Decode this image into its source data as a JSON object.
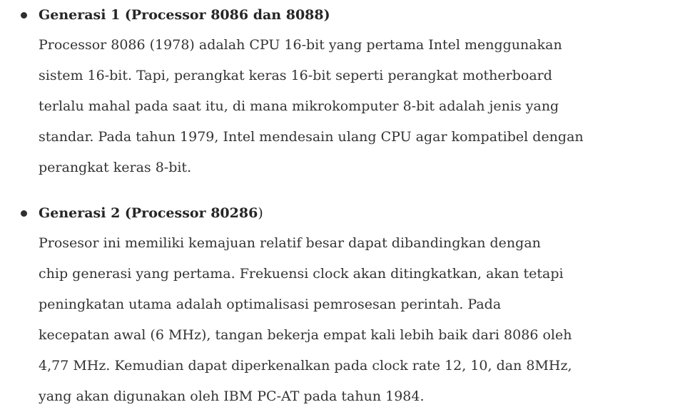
{
  "generations": [
    {
      "heading_bold": "Generasi 1 (Processor 8086 dan 8088)",
      "heading_tail": "",
      "lines": [
        "Processor 8086 (1978) adalah CPU 16-bit yang pertama Intel menggunakan",
        "sistem 16-bit. Tapi, perangkat keras 16-bit seperti perangkat motherboard",
        "terlalu mahal pada saat itu, di mana mikrokomputer 8-bit adalah jenis yang",
        "standar. Pada tahun 1979, Intel mendesain ulang CPU agar kompatibel dengan",
        "perangkat keras 8-bit."
      ]
    },
    {
      "heading_bold": "Generasi 2 (Processor 80286",
      "heading_tail": ")",
      "lines": [
        "Prosesor ini memiliki kemajuan relatif besar dapat dibandingkan dengan",
        "chip generasi yang pertama. Frekuensi clock akan ditingkatkan, akan tetapi",
        "peningkatan utama adalah optimalisasi pemrosesan perintah. Pada",
        "kecepatan awal (6 MHz), tangan bekerja empat kali lebih baik dari 8086 oleh",
        "4,77 MHz. Kemudian dapat diperkenalkan pada clock rate 12, 10, dan 8MHz,",
        "yang akan digunakan oleh IBM PC-AT pada tahun 1984."
      ]
    }
  ]
}
